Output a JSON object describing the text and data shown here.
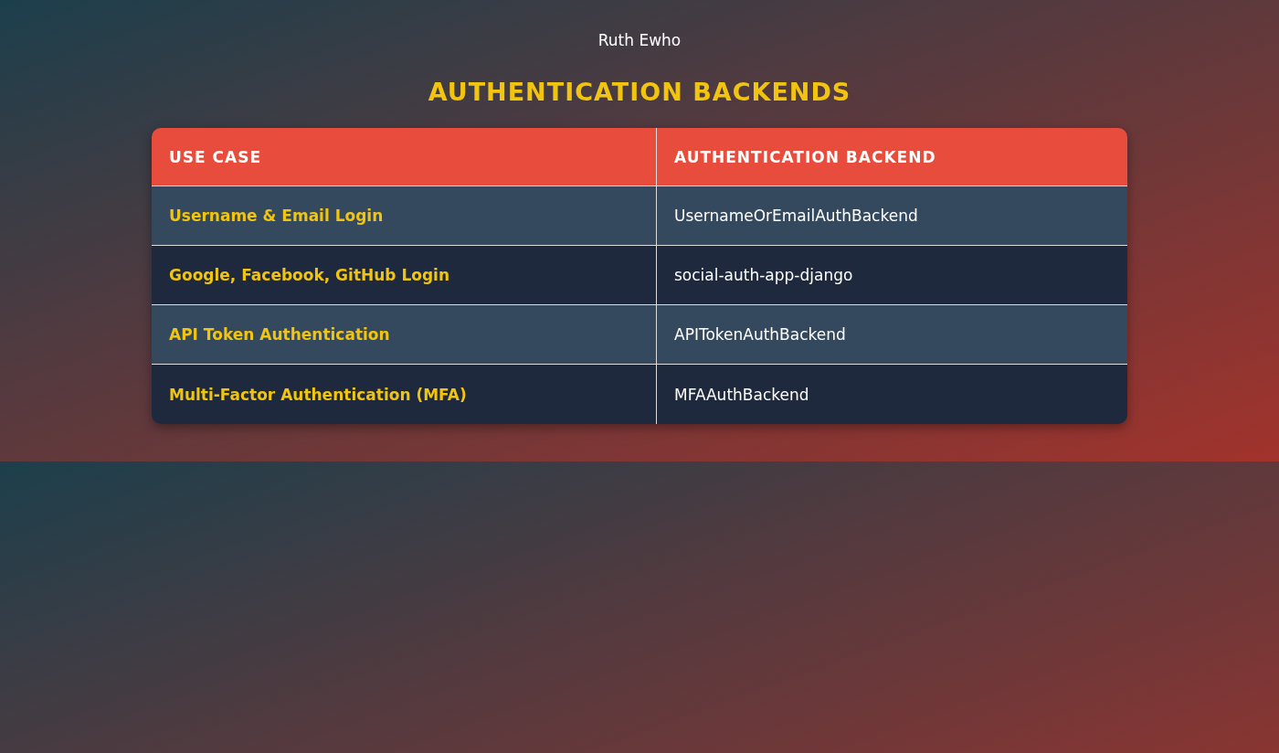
{
  "author": "Ruth Ewho",
  "title": "AUTHENTICATION BACKENDS",
  "table": {
    "columns": [
      "USE CASE",
      "AUTHENTICATION BACKEND"
    ],
    "rows": [
      {
        "use_case": "Username & Email Login",
        "backend": "UsernameOrEmailAuthBackend"
      },
      {
        "use_case": "Google, Facebook, GitHub Login",
        "backend": "social-auth-app-django"
      },
      {
        "use_case": "API Token Authentication",
        "backend": "APITokenAuthBackend"
      },
      {
        "use_case": "Multi-Factor Authentication (MFA)",
        "backend": "MFAAuthBackend"
      }
    ]
  }
}
